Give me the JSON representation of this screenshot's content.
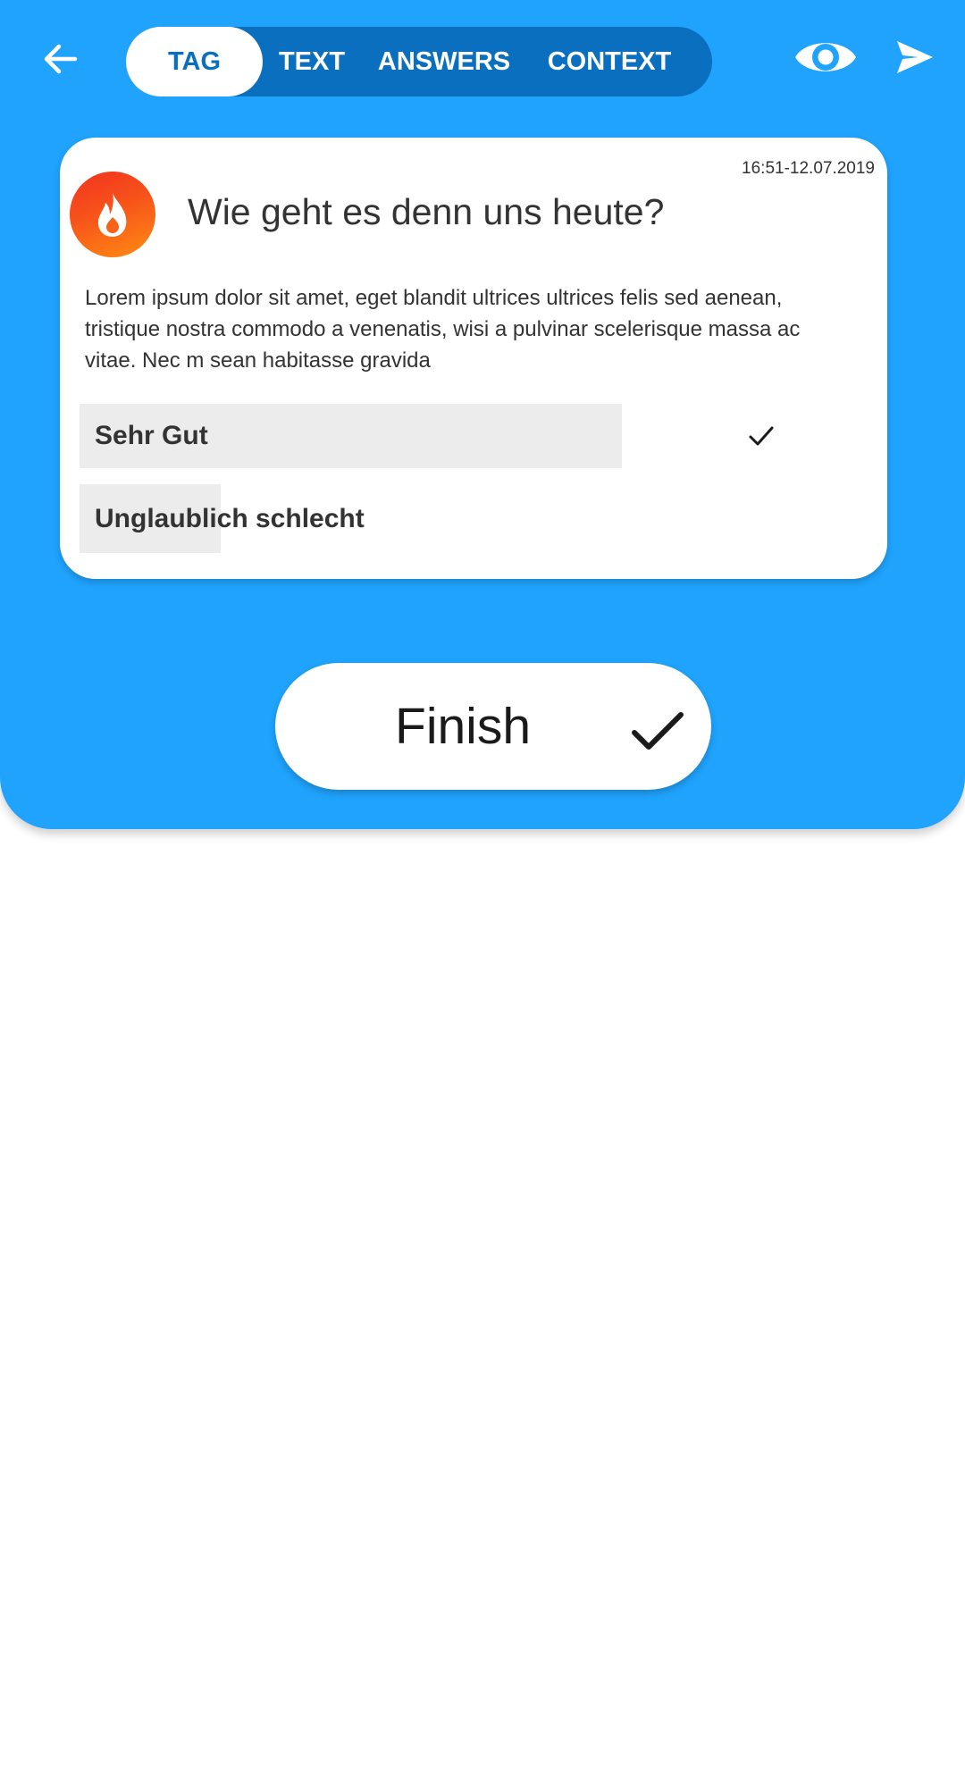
{
  "header": {
    "back_icon": "arrow-left-icon",
    "tabs": [
      {
        "label": "TAG",
        "active": true
      },
      {
        "label": "TEXT",
        "active": false
      },
      {
        "label": "ANSWERS",
        "active": false
      },
      {
        "label": "CONTEXT",
        "active": false
      }
    ],
    "preview_icon": "eye-icon",
    "send_icon": "send-icon"
  },
  "card": {
    "timestamp": "16:51-12.07.2019",
    "avatar_icon": "flame-icon",
    "question": "Wie geht es denn uns heute?",
    "description": "Lorem ipsum dolor sit amet, eget blandit ultrices ultrices felis sed aenean, tristique nostra commodo a venenatis, wisi a pulvinar scelerisque massa ac vitae. Nec m sean habitasse gravida",
    "answers": [
      {
        "label": "Sehr Gut",
        "share": 0.69,
        "selected": true
      },
      {
        "label": "Unglaublich schlecht",
        "share": 0.18,
        "selected": false
      }
    ]
  },
  "finish": {
    "label": "Finish",
    "icon": "checkmark-icon"
  },
  "colors": {
    "primary": "#1fa3fd",
    "tab_track": "#0b6fc0",
    "answer_fill": "#ececec",
    "avatar_gradient": [
      "#f2321f",
      "#ff8c12"
    ]
  }
}
